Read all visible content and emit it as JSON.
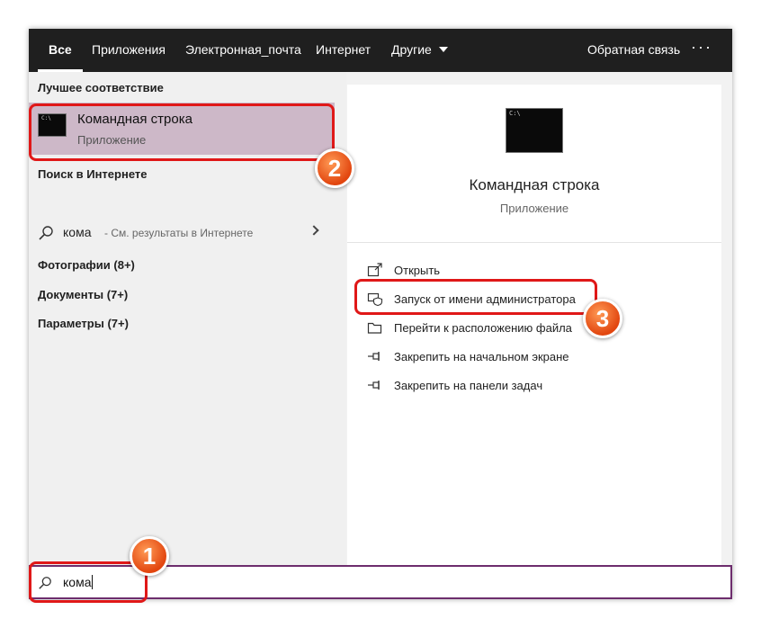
{
  "tabs": [
    {
      "label": "Все"
    },
    {
      "label": "Приложения"
    },
    {
      "label": "Электронная_почта"
    },
    {
      "label": "Интернет"
    },
    {
      "label": "Другие"
    }
  ],
  "header": {
    "feedback": "Обратная связь",
    "more": "···"
  },
  "left": {
    "best_match_title": "Лучшее соответствие",
    "best_match": {
      "name": "Командная строка",
      "type": "Приложение"
    },
    "web_title": "Поиск в Интернете",
    "web_result": {
      "query": "кома",
      "hint": "- См. результаты в Интернете"
    },
    "categories": [
      {
        "label": "Фотографии (8+)"
      },
      {
        "label": "Документы (7+)"
      },
      {
        "label": "Параметры (7+)"
      }
    ]
  },
  "right": {
    "app_name": "Командная строка",
    "app_type": "Приложение",
    "actions": [
      {
        "label": "Открыть",
        "icon": "open-icon"
      },
      {
        "label": "Запуск от имени администратора",
        "icon": "admin-shield-icon"
      },
      {
        "label": "Перейти к расположению файла",
        "icon": "folder-icon"
      },
      {
        "label": "Закрепить на начальном экране",
        "icon": "pin-icon"
      },
      {
        "label": "Закрепить на панели задач",
        "icon": "pin-icon"
      }
    ]
  },
  "search": {
    "value": "кома"
  },
  "annotations": {
    "badge1": "1",
    "badge2": "2",
    "badge3": "3"
  },
  "colors": {
    "highlight": "#cdb8c8",
    "annotation": "#e01818",
    "badge": "#e2460f",
    "search_border": "#6d2d6d"
  }
}
